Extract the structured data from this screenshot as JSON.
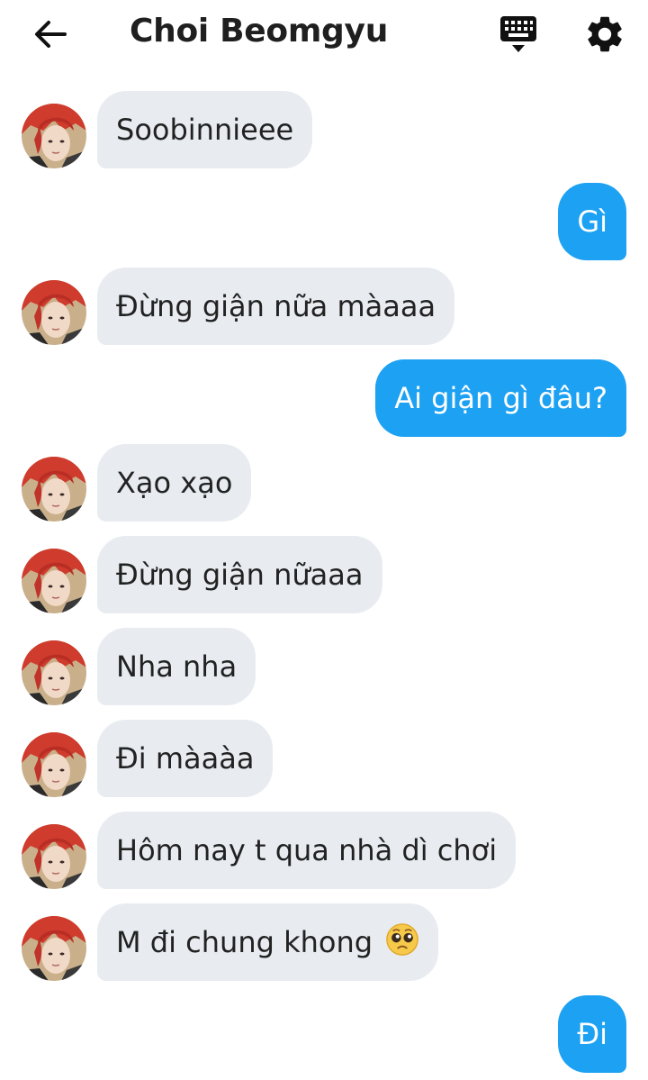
{
  "header": {
    "title": "Choi Beomgyu",
    "icons": [
      "back-arrow-icon",
      "keyboard-icon",
      "settings-icon"
    ]
  },
  "colors": {
    "incoming_bubble": "#e8ecf1",
    "outgoing_bubble": "#1da1f2",
    "avatar_hair": "#d33a2c"
  },
  "messages": [
    {
      "from": "them",
      "text": "Soobinnieee"
    },
    {
      "from": "me",
      "text": "Gì"
    },
    {
      "from": "them",
      "text": "Đừng giận nữa màaaa"
    },
    {
      "from": "me",
      "text": "Ai giận gì đâu?"
    },
    {
      "from": "them",
      "text": "Xạo xạo"
    },
    {
      "from": "them",
      "text": "Đừng giận nữaaa"
    },
    {
      "from": "them",
      "text": "Nha nha"
    },
    {
      "from": "them",
      "text": "Đi màaàa"
    },
    {
      "from": "them",
      "text": "Hôm nay t qua nhà dì chơi"
    },
    {
      "from": "them",
      "text": "M đi chung khong",
      "emoji": "pleading-face-emoji"
    },
    {
      "from": "me",
      "text": "Đi"
    }
  ]
}
